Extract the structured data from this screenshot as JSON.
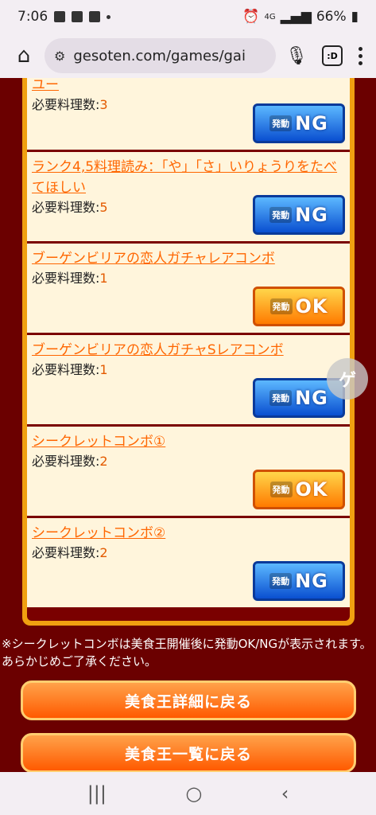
{
  "status": {
    "time": "7:06",
    "network": "4G",
    "battery": "66%"
  },
  "browser": {
    "url": "gesoten.com/games/gai",
    "tab_label": ":D"
  },
  "combos": [
    {
      "title": "ユー",
      "req_label": "必要料理数:",
      "req_value": "3",
      "badge": "NG"
    },
    {
      "title": "ランク4,5料理読み：「や」「さ」いりょうりをたべてほしい",
      "req_label": "必要料理数:",
      "req_value": "5",
      "badge": "NG"
    },
    {
      "title": "ブーゲンビリアの恋人ガチャレアコンボ",
      "req_label": "必要料理数:",
      "req_value": "1",
      "badge": "OK"
    },
    {
      "title": "ブーゲンビリアの恋人ガチャSレアコンボ",
      "req_label": "必要料理数:",
      "req_value": "1",
      "badge": "NG"
    },
    {
      "title": "シークレットコンボ①",
      "req_label": "必要料理数:",
      "req_value": "2",
      "badge": "OK"
    },
    {
      "title": "シークレットコンボ②",
      "req_label": "必要料理数:",
      "req_value": "2",
      "badge": "NG"
    }
  ],
  "badge_prefix": "発動",
  "note": "※シークレットコンボは美食王開催後に発動OK/NGが表示されます。あらかじめご了承ください。",
  "buttons": {
    "back_detail": "美食王詳細に戻る",
    "back_list": "美食王一覧に戻る"
  },
  "floating_label": "ゲ",
  "colors": {
    "background": "#6b0000",
    "frame": "#f0a010",
    "link": "#ff6600",
    "ng": "#0a4fd0",
    "ok": "#ff7a00"
  }
}
